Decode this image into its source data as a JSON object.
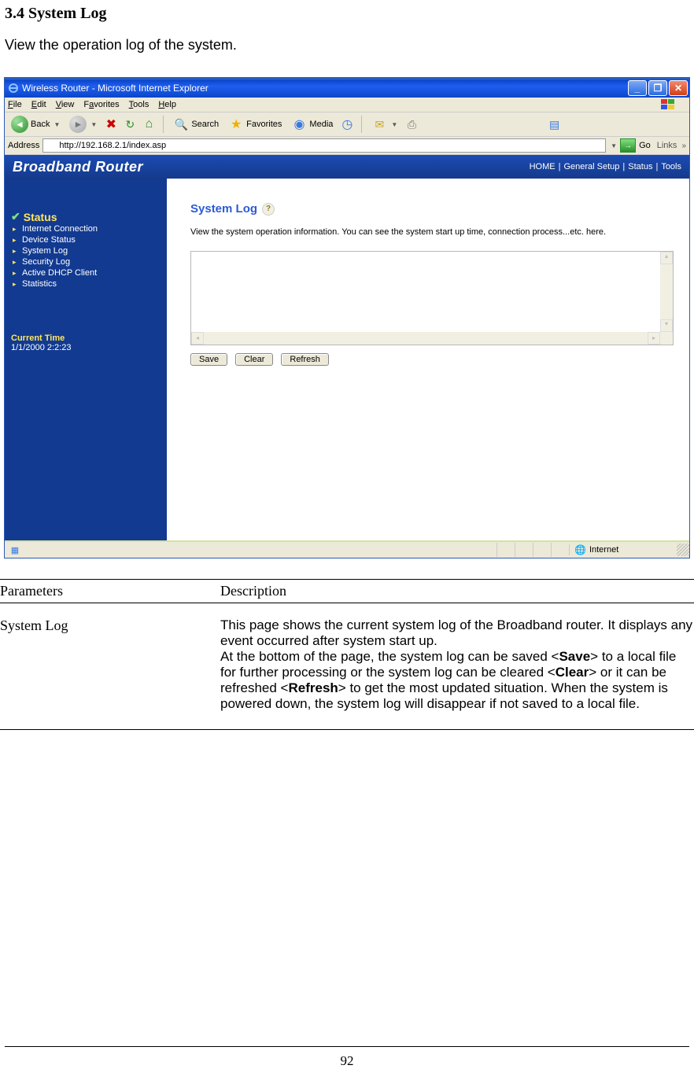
{
  "doc": {
    "heading": "3.4 System Log",
    "intro": "View the operation log of the system.",
    "table": {
      "headers": [
        "Parameters",
        "Description"
      ],
      "rows": [
        {
          "param": "System Log",
          "desc_pre": "This page shows the current system log of the Broadband router. It displays any event occurred after system start up.\nAt the bottom of the page, the system log can be saved <",
          "bold1": "Save",
          "desc_mid1": "> to a local file for further processing or the system log can be cleared <",
          "bold2": "Clear",
          "desc_mid2": "> or it can be refreshed <",
          "bold3": "Refresh",
          "desc_post": "> to get the most updated situation. When the system is powered down, the system log will disappear if not saved to a local file."
        }
      ]
    },
    "page_number": "92"
  },
  "ie": {
    "title": "Wireless Router - Microsoft Internet Explorer",
    "menus": [
      "File",
      "Edit",
      "View",
      "Favorites",
      "Tools",
      "Help"
    ],
    "toolbar": {
      "back": "Back",
      "search": "Search",
      "favorites": "Favorites",
      "media": "Media"
    },
    "address_label": "Address",
    "address_value": "http://192.168.2.1/index.asp",
    "go_label": "Go",
    "links_label": "Links",
    "status": {
      "zone": "Internet"
    }
  },
  "router": {
    "brand": "Broadband Router",
    "topnav": [
      "HOME",
      "|",
      "General Setup",
      "|",
      "Status",
      "|",
      "Tools"
    ],
    "sidebar": {
      "header": "Status",
      "items": [
        "Internet Connection",
        "Device Status",
        "System Log",
        "Security Log",
        "Active DHCP Client",
        "Statistics"
      ],
      "current_time_label": "Current Time",
      "current_time_value": "1/1/2000 2:2:23"
    },
    "page": {
      "title": "System Log",
      "desc": "View the system operation information. You can see the system start up time, connection process...etc. here.",
      "buttons": {
        "save": "Save",
        "clear": "Clear",
        "refresh": "Refresh"
      }
    }
  }
}
